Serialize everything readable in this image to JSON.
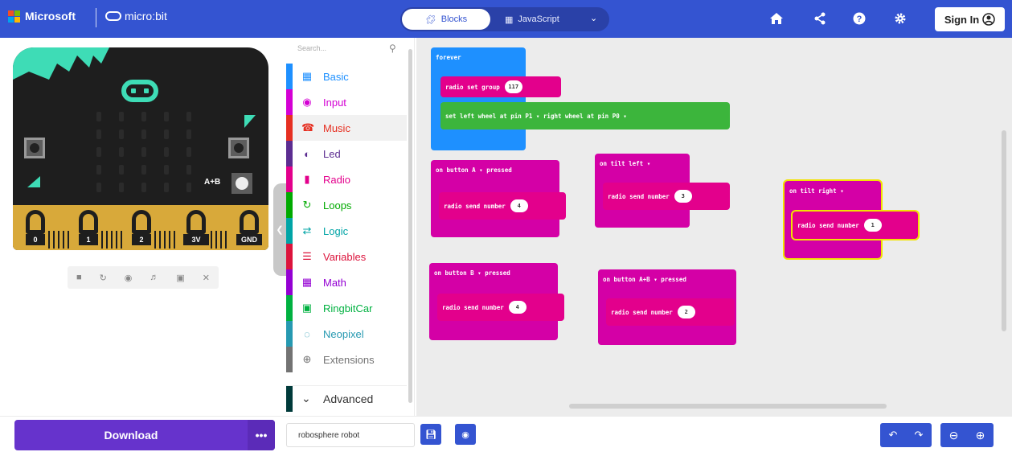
{
  "header": {
    "brand": "Microsoft",
    "product": "micro:bit",
    "tabs": [
      {
        "label": "Blocks",
        "icon": "puzzle-icon",
        "active": true
      },
      {
        "label": "JavaScript",
        "icon": "code-icon",
        "active": false
      }
    ],
    "signin_label": "Sign In",
    "colors": {
      "bar": "#3454d1"
    }
  },
  "simulator": {
    "pin_labels": [
      "0",
      "1",
      "2",
      "3V",
      "GND"
    ],
    "ab_label": "A+B"
  },
  "toolbox": {
    "search_placeholder": "Search...",
    "categories": [
      {
        "label": "Basic",
        "color": "#1e90ff",
        "icon": "grid-icon"
      },
      {
        "label": "Input",
        "color": "#d400d4",
        "icon": "target-icon"
      },
      {
        "label": "Music",
        "color": "#e63022",
        "icon": "headphones-icon"
      },
      {
        "label": "Led",
        "color": "#5c2d91",
        "icon": "toggle-icon"
      },
      {
        "label": "Radio",
        "color": "#e3008c",
        "icon": "signal-icon"
      },
      {
        "label": "Loops",
        "color": "#00aa00",
        "icon": "loop-icon"
      },
      {
        "label": "Logic",
        "color": "#00a4a6",
        "icon": "shuffle-icon"
      },
      {
        "label": "Variables",
        "color": "#dc143c",
        "icon": "list-icon"
      },
      {
        "label": "Math",
        "color": "#9400d3",
        "icon": "calculator-icon"
      },
      {
        "label": "RingbitCar",
        "color": "#00b140",
        "icon": "car-icon"
      },
      {
        "label": "Neopixel",
        "color": "#2699b1",
        "icon": "ring-icon"
      },
      {
        "label": "Extensions",
        "color": "#737373",
        "icon": "plus-circle-icon"
      }
    ],
    "advanced_label": "Advanced"
  },
  "workspace": {
    "forever": {
      "label": "forever",
      "set_group": {
        "text": "radio set group",
        "value": "117"
      },
      "wheel": {
        "text": "set left wheel at pin  P1 ▾  right wheel at pin  P0 ▾"
      }
    },
    "button_a": {
      "label": "on button  A ▾  pressed",
      "inner": "radio send number",
      "value": "4"
    },
    "tilt_left": {
      "label": "on  tilt left ▾",
      "inner": "radio send number",
      "value": "3"
    },
    "tilt_right": {
      "label": "on  tilt right ▾",
      "inner": "radio send number",
      "value": "1"
    },
    "button_b": {
      "label": "on button  B ▾  pressed",
      "inner": "radio send number",
      "value": "4"
    },
    "button_ab": {
      "label": "on button  A+B ▾  pressed",
      "inner": "radio send number",
      "value": "2"
    }
  },
  "bottom": {
    "download_label": "Download",
    "more_label": "•••",
    "project_name": "robosphere robot"
  }
}
